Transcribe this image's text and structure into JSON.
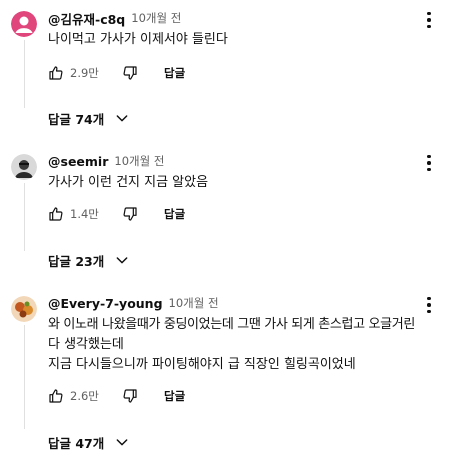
{
  "comments": [
    {
      "author": "@김유재-c8q",
      "time": "10개월 전",
      "lines": [
        "나이먹고 가사가 이제서야 들린다"
      ],
      "likes": "2.9만",
      "reply_label": "답글",
      "replies_label": "답글 74개",
      "avatar_color": "#e0457b"
    },
    {
      "author": "@seemir",
      "time": "10개월 전",
      "lines": [
        "가사가 이런 건지 지금 알았음"
      ],
      "likes": "1.4만",
      "reply_label": "답글",
      "replies_label": "답글 23개",
      "avatar_color": "#3a3a3a"
    },
    {
      "author": "@Every-7-young",
      "time": "10개월 전",
      "lines": [
        "와 이노래 나왔을때가 중딩이었는데 그땐 가사 되게 촌스럽고 오글거린",
        "다 생각했는데",
        "지금 다시들으니까 파이팅해야지 급 직장인 힐링곡이었네"
      ],
      "likes": "2.6만",
      "reply_label": "답글",
      "replies_label": "답글 47개",
      "avatar_color": "#c2571f"
    }
  ]
}
